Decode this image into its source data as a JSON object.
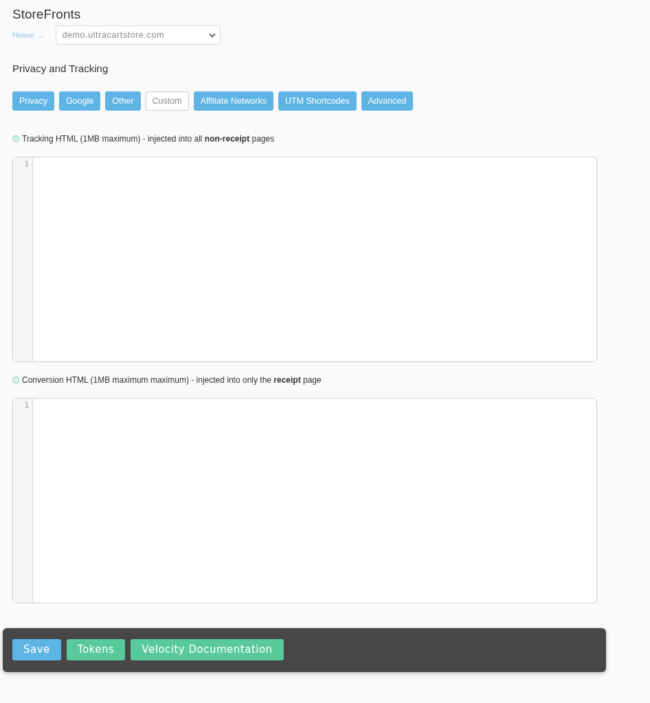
{
  "page": {
    "title": "StoreFronts"
  },
  "breadcrumb": {
    "home": "Home",
    "arrow": "→"
  },
  "store_select": {
    "value": "demo.ultracartstore.com"
  },
  "section_title": "Privacy and Tracking",
  "tabs": [
    {
      "label": "Privacy",
      "selected": false
    },
    {
      "label": "Google",
      "selected": false
    },
    {
      "label": "Other",
      "selected": false
    },
    {
      "label": "Custom",
      "selected": true
    },
    {
      "label": "Affiliate Networks",
      "selected": false
    },
    {
      "label": "UTM Shortcodes",
      "selected": false
    },
    {
      "label": "Advanced",
      "selected": false
    }
  ],
  "editors": [
    {
      "label": "Tracking HTML (1MB maximum) - injected into all **non-receipt** pages",
      "line_numbers": [
        "1"
      ]
    },
    {
      "label": "Conversion HTML (1MB maximum maximum) - injected into only the **receipt** page",
      "line_numbers": [
        "1"
      ]
    }
  ],
  "footer": {
    "buttons": [
      {
        "label": "Save",
        "kind": "primary"
      },
      {
        "label": "Tokens",
        "kind": "success"
      },
      {
        "label": "Velocity Documentation",
        "kind": "success"
      }
    ]
  }
}
